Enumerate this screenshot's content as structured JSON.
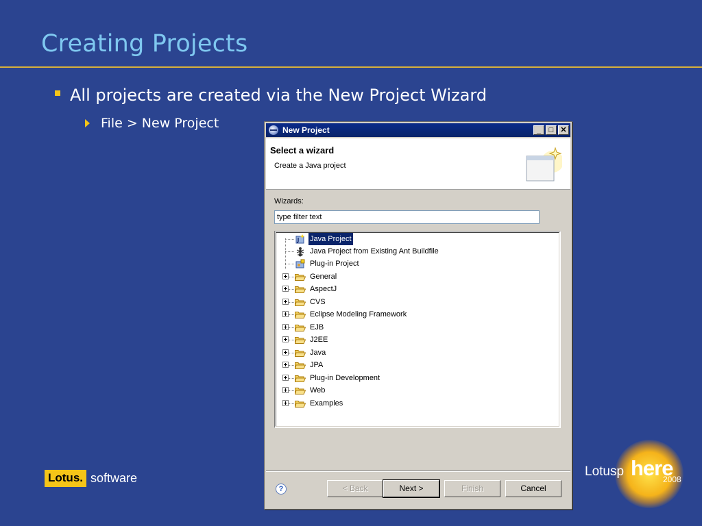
{
  "slide": {
    "title": "Creating Projects",
    "bullet1": "All projects are created via the New Project Wizard",
    "bullet2": "File > New Project"
  },
  "dialog": {
    "title": "New Project",
    "header_title": "Select a wizard",
    "header_desc": "Create a Java project",
    "wizards_label": "Wizards:",
    "filter_value": "type filter text",
    "items": [
      {
        "label": "Java Project",
        "type": "leaf",
        "icon": "java-project-icon",
        "selected": true
      },
      {
        "label": "Java Project from Existing Ant Buildfile",
        "type": "leaf",
        "icon": "ant-icon"
      },
      {
        "label": "Plug-in Project",
        "type": "leaf",
        "icon": "plugin-icon"
      },
      {
        "label": "General",
        "type": "folder"
      },
      {
        "label": "AspectJ",
        "type": "folder"
      },
      {
        "label": "CVS",
        "type": "folder"
      },
      {
        "label": "Eclipse Modeling Framework",
        "type": "folder"
      },
      {
        "label": "EJB",
        "type": "folder"
      },
      {
        "label": "J2EE",
        "type": "folder"
      },
      {
        "label": "Java",
        "type": "folder"
      },
      {
        "label": "JPA",
        "type": "folder"
      },
      {
        "label": "Plug-in Development",
        "type": "folder"
      },
      {
        "label": "Web",
        "type": "folder"
      },
      {
        "label": "Examples",
        "type": "folder"
      }
    ],
    "buttons": {
      "back": "< Back",
      "next": "Next >",
      "finish": "Finish",
      "cancel": "Cancel"
    }
  },
  "footer": {
    "lotus_brand": "Lotus.",
    "lotus_software": "software",
    "lotusphere_prefix": "Lotusp",
    "lotusphere_here": "here",
    "lotusphere_year": "2008"
  },
  "colors": {
    "background": "#2b4490",
    "title": "#7fc8f0",
    "accent": "#f5c518",
    "selection": "#0a246a"
  }
}
